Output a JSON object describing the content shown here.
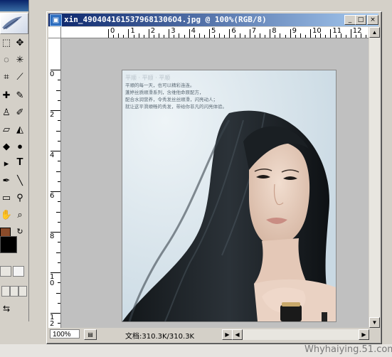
{
  "document": {
    "title": "xin_4904041615379681306O4.jpg @ 100%(RGB/8)",
    "window_buttons": {
      "minimize": "_",
      "maximize": "□",
      "close": "×"
    }
  },
  "rulers": {
    "top_labels": [
      "0",
      "1",
      "2",
      "3",
      "4",
      "5",
      "6",
      "7",
      "8",
      "9",
      "10",
      "11",
      "12"
    ],
    "left_labels": [
      "0",
      "2",
      "4",
      "6",
      "8",
      "1\n0",
      "1\n2"
    ]
  },
  "image": {
    "ad_heading": "平顺 · 平顺 · 平顺",
    "ad_lines": [
      "平顺的每一天，也可以精彩连连。",
      "蓬婷丝质顺滑系列，含维他命原配方，",
      "配合水润营养，令秀发丝丝顺滑，闪亮动人；",
      "就让这平滑顺畅的秀发，带给你非凡的闪亮体验。"
    ]
  },
  "status": {
    "zoom": "100%",
    "doc_info": "文档:310.3K/310.3K"
  },
  "toolbox": {
    "tools": [
      "move-tool",
      "lasso-tool",
      "magic-wand-tool",
      "brush-tool",
      "eraser-tool",
      "paint-bucket-tool",
      "dodge-tool",
      "pen-tool",
      "type-tool",
      "line-tool",
      "eyedropper-tool",
      "zoom-tool"
    ],
    "type_glyph": "T",
    "foreground_color": "#8a4b2a",
    "background_color": "#000000"
  },
  "watermark": "Whyhaiying.51.com",
  "colors": {
    "titlebar_start": "#0a246a",
    "titlebar_end": "#a6caf0",
    "canvas_bg": "#c0c0c0",
    "chrome": "#d4d0c8"
  }
}
